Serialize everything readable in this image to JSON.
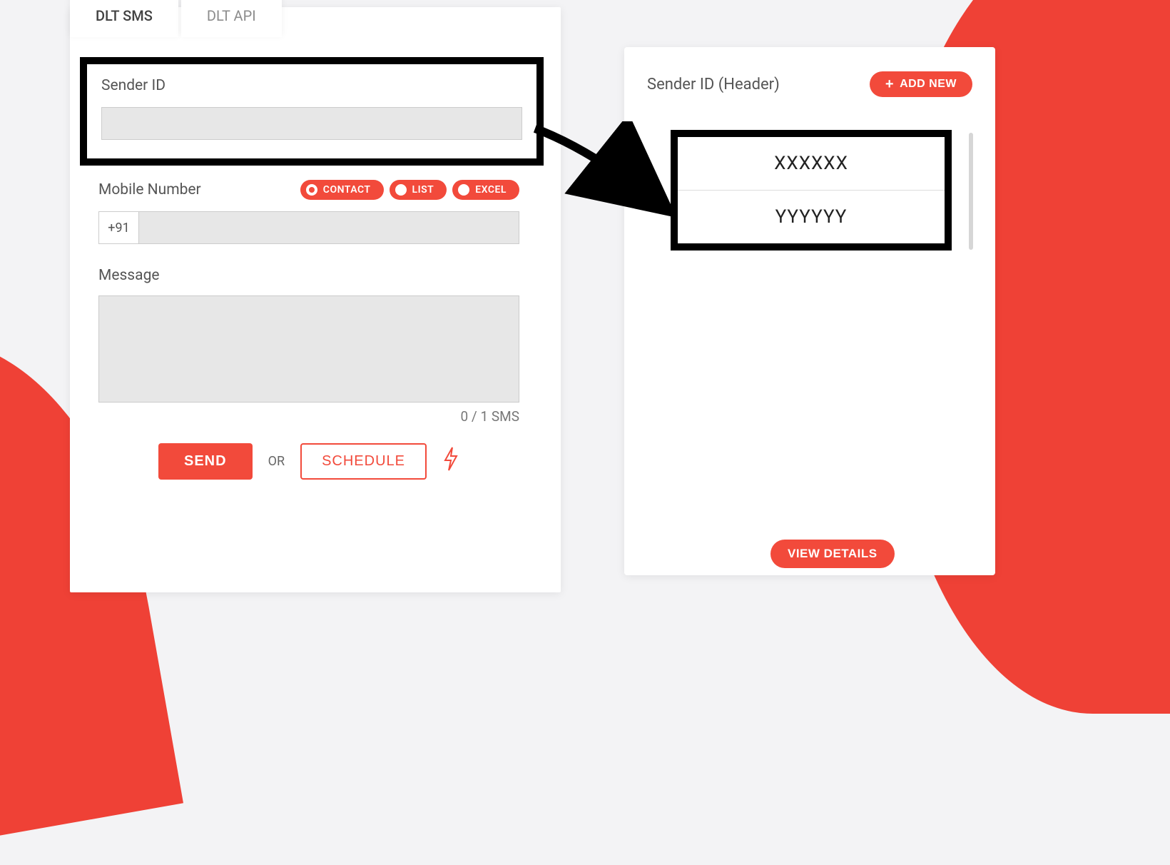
{
  "tabs": {
    "sms": "DLT SMS",
    "api": "DLT API"
  },
  "form": {
    "sender_label": "Sender ID",
    "mobile_label": "Mobile Number",
    "mobile_prefix": "+91",
    "message_label": "Message",
    "counter": "0 / 1 SMS",
    "pills": {
      "contact": "CONTACT",
      "list": "LIST",
      "excel": "EXCEL"
    },
    "send": "SEND",
    "or": "OR",
    "schedule": "SCHEDULE"
  },
  "right": {
    "title": "Sender ID (Header)",
    "add_new": "ADD NEW",
    "items": {
      "0": "XXXXXX",
      "1": "YYYYYY"
    },
    "view_details": "VIEW DETAILS"
  }
}
